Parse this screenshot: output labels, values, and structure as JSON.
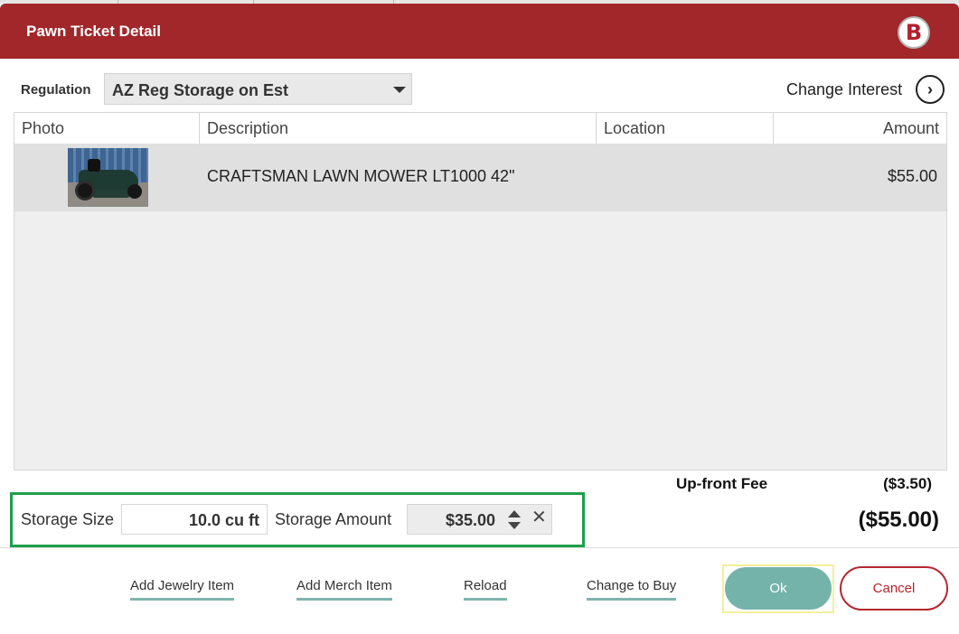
{
  "window": {
    "title": "Pawn Ticket Detail",
    "logo_text": "B",
    "logo_icon": "brand-logo-icon"
  },
  "regulation": {
    "label": "Regulation",
    "selected": "AZ Reg Storage on Est"
  },
  "change_interest": {
    "label": "Change Interest",
    "icon": "chevron-right-circle-icon"
  },
  "grid": {
    "columns": [
      "Photo",
      "Description",
      "Location",
      "Amount"
    ],
    "rows": [
      {
        "photo": "lawn-mower-photo",
        "description": "CRAFTSMAN LAWN MOWER LT1000 42\"",
        "location": "",
        "amount": "$55.00"
      }
    ]
  },
  "fees": {
    "upfront_label": "Up-front Fee",
    "upfront_value": "($3.50)",
    "total": "($55.00)"
  },
  "storage": {
    "size_label": "Storage Size",
    "size_value": "10.0 cu ft",
    "amount_label": "Storage Amount",
    "amount_value": "$35.00"
  },
  "footer": {
    "links": [
      "Add Jewelry Item",
      "Add Merch Item",
      "Reload",
      "Change to Buy"
    ],
    "ok_label": "Ok",
    "cancel_label": "Cancel"
  },
  "colors": {
    "titlebar": "#a1272a",
    "accent_teal": "#74b3aa",
    "highlight_green": "#1f9f4a",
    "cancel_red": "#b4262e"
  }
}
